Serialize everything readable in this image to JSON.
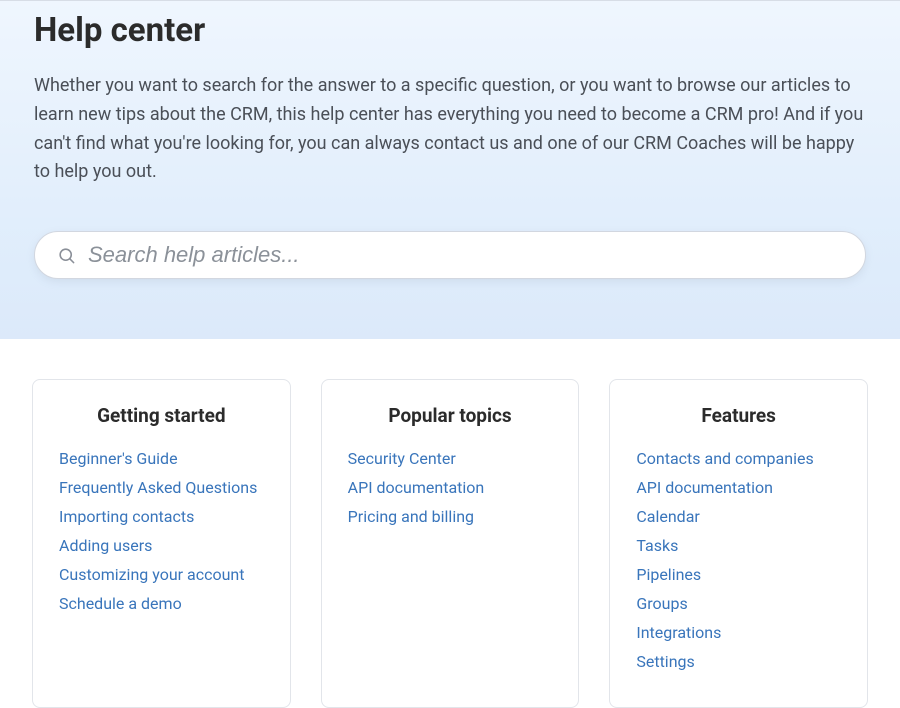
{
  "hero": {
    "title": "Help center",
    "intro": "Whether you want to search for the answer to a specific question, or you want to browse our articles to learn new tips about the CRM, this help center has everything you need to become a CRM pro! And if you can't find what you're looking for, you can always contact us and one of our CRM Coaches will be happy to help you out.",
    "search_placeholder": "Search help articles..."
  },
  "cards": [
    {
      "title": "Getting started",
      "links": [
        "Beginner's Guide",
        "Frequently Asked Questions",
        "Importing contacts",
        "Adding users",
        "Customizing your account",
        "Schedule a demo"
      ]
    },
    {
      "title": "Popular topics",
      "links": [
        "Security Center",
        "API documentation",
        "Pricing and billing"
      ]
    },
    {
      "title": "Features",
      "links": [
        "Contacts and companies",
        "API documentation",
        "Calendar",
        "Tasks",
        "Pipelines",
        "Groups",
        "Integrations",
        "Settings"
      ]
    }
  ]
}
